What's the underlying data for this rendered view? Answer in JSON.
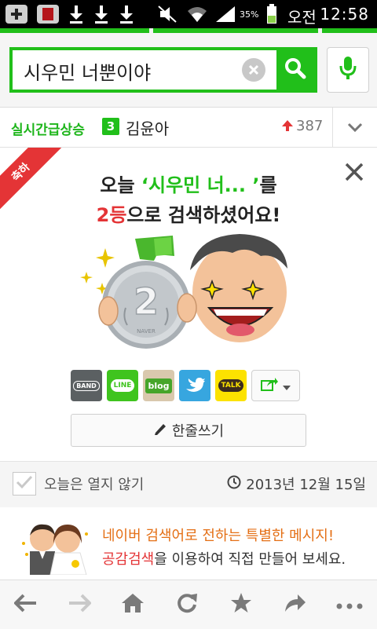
{
  "status_bar": {
    "battery_percent": "35%",
    "ampm": "오전",
    "time": "12:58",
    "icons": [
      "add-icon",
      "app-icon",
      "download-icon",
      "download-icon",
      "download-icon",
      "mute-icon",
      "wifi-icon",
      "signal-icon",
      "battery-icon"
    ]
  },
  "search": {
    "query": "시우민 너뿐이야",
    "clear_icon": "clear-icon",
    "search_icon": "search-icon",
    "voice_icon": "mic-icon",
    "accent_color": "#21bf1a"
  },
  "realtime": {
    "label": "실시간급상승",
    "rank": "3",
    "keyword": "김윤아",
    "count": "387",
    "trend_icon": "up-arrow-icon",
    "expand_icon": "chevron-down-icon"
  },
  "card": {
    "ribbon_label": "축하",
    "line1_prefix": "오늘 ",
    "line1_keyword": "‘시우민 너...  ’",
    "line1_suffix": "를",
    "line2_rank": "2등",
    "line2_suffix": "으로 검색하셨어요!",
    "medal_number": "2",
    "medal_text": "NAVER",
    "share": {
      "band": "BAND",
      "line": "LINE",
      "blog": "blog",
      "twitter": "twitter-icon",
      "talk": "TALK",
      "more": "share-more-icon"
    },
    "comment_button": "한줄쓰기"
  },
  "options": {
    "dont_open_today": "오늘은 열지 않기",
    "date": "2013년 12월 15일"
  },
  "promo": {
    "line1": "네이버 검색어로 전하는 특별한 메시지!",
    "line2_highlight": "공감검색",
    "line2_rest": "을 이용하여 직접 만들어 보세요."
  },
  "bottom_nav": {
    "items": [
      "back-icon",
      "forward-icon",
      "home-icon",
      "refresh-icon",
      "bookmark-icon",
      "share-icon",
      "more-icon"
    ]
  }
}
